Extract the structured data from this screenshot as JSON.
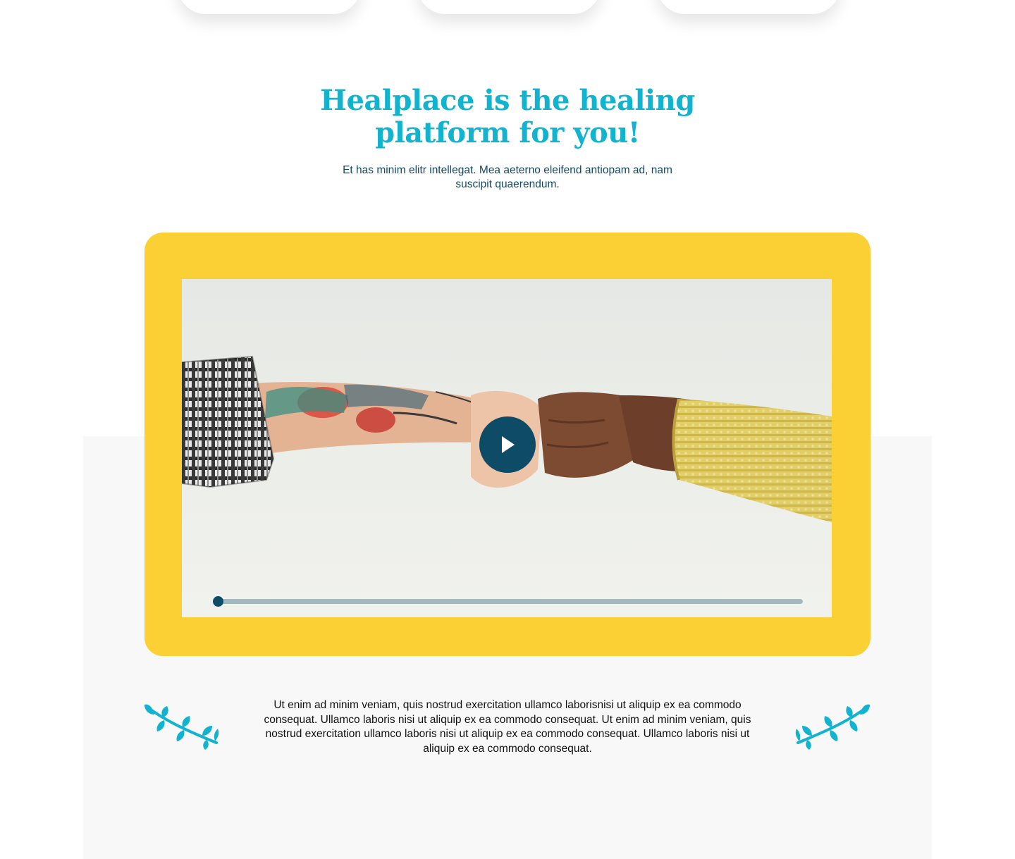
{
  "hero": {
    "title": "Healplace is the healing platform for you!",
    "subtitle": "Et has minim elitr intellegat. Mea aeterno eleifend antiopam ad, nam suscipit quaerendum."
  },
  "video": {
    "progress": 0,
    "play_icon": "play-icon"
  },
  "body": {
    "paragraph": "Ut enim ad minim veniam, quis nostrud exercitation ullamco laborisnisi ut aliquip ex ea commodo consequat. Ullamco laboris nisi ut aliquip ex ea commodo consequat. Ut enim ad minim veniam, quis nostrud exercitation ullamco laboris nisi ut aliquip ex ea commodo consequat.  Ullamco laboris nisi ut aliquip ex ea commodo consequat."
  },
  "decor": {
    "left_icon": "leaf-branch-icon",
    "right_icon": "leaf-branch-icon"
  },
  "colors": {
    "accent": "#12b3cf",
    "navy": "#0d4b66",
    "frame": "#fbd035"
  }
}
